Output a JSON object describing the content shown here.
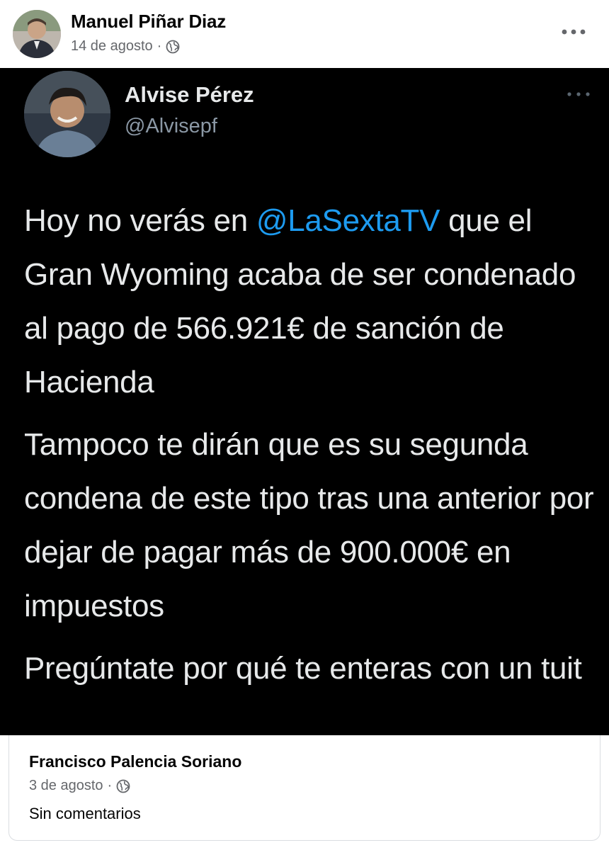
{
  "post": {
    "author": "Manuel Piñar Diaz",
    "date": "14 de agosto",
    "separator": "·",
    "audience_icon": "globe-icon",
    "more_icon": "ellipsis-icon"
  },
  "tweet": {
    "name": "Alvise Pérez",
    "handle": "@Alvisepf",
    "paragraph1_before": "Hoy no verás en ",
    "mention": "@LaSextaTV",
    "paragraph1_after": " que el Gran Wyoming acaba de ser condenado al pago de 566.921€ de sanción de Hacienda",
    "paragraph2": "Tampoco te dirán que es su segunda condena de este tipo tras una anterior por dejar de pagar más de 900.000€ en impuestos",
    "paragraph3": "Pregúntate por qué te enteras con un tuit",
    "mention_color": "#1d9bf0"
  },
  "shared": {
    "author": "Francisco Palencia Soriano",
    "date": "3 de agosto",
    "separator": "·",
    "audience_icon": "globe-icon",
    "body": "Sin comentarios"
  }
}
